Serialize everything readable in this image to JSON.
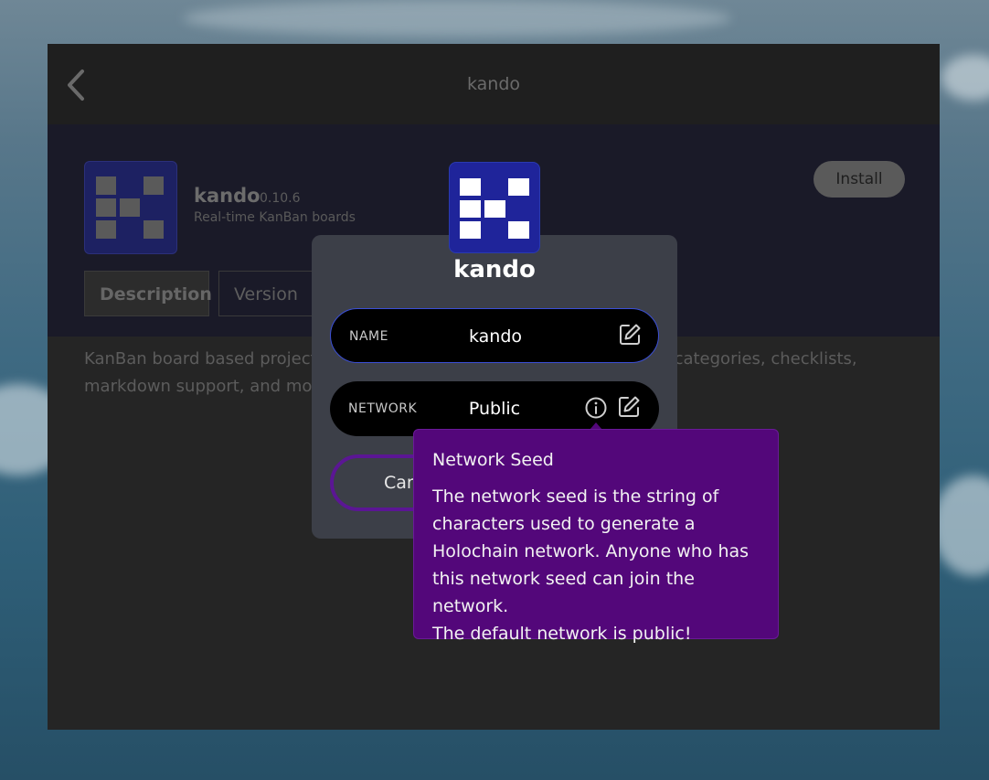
{
  "window": {
    "title": "kando"
  },
  "app": {
    "name": "kando",
    "version": "0.10.6",
    "tagline": "Real-time KanBan boards",
    "install_label": "Install",
    "description": "KanBan board based project management with real-time collaboration, labels, categories, checklists, markdown support, and more.",
    "description_visible_left": "KanBan board based project",
    "description_visible_right": "els, categories, checklists,",
    "description_line2": "markdown support, and mor"
  },
  "tabs": [
    {
      "label": "Description",
      "active": true
    },
    {
      "label": "Version H",
      "active": false
    }
  ],
  "modal": {
    "title": "kando",
    "name_field": {
      "label": "NAME",
      "value": "kando"
    },
    "network_field": {
      "label": "NETWORK",
      "value": "Public"
    },
    "cancel_label": "Can"
  },
  "tooltip": {
    "title": "Network Seed",
    "lines": [
      "The network seed is the string of",
      "characters used to generate a",
      "Holochain network. Anyone who has",
      "this network seed can join the network.",
      "The default network is public!"
    ]
  },
  "colors": {
    "accent": "#3b4fd6",
    "tooltip_bg": "#53077a",
    "cancel_border": "#5b1694",
    "app_icon_bg": "#1f249a"
  },
  "icons": [
    "back-icon",
    "edit-icon",
    "info-icon",
    "app-icon"
  ]
}
